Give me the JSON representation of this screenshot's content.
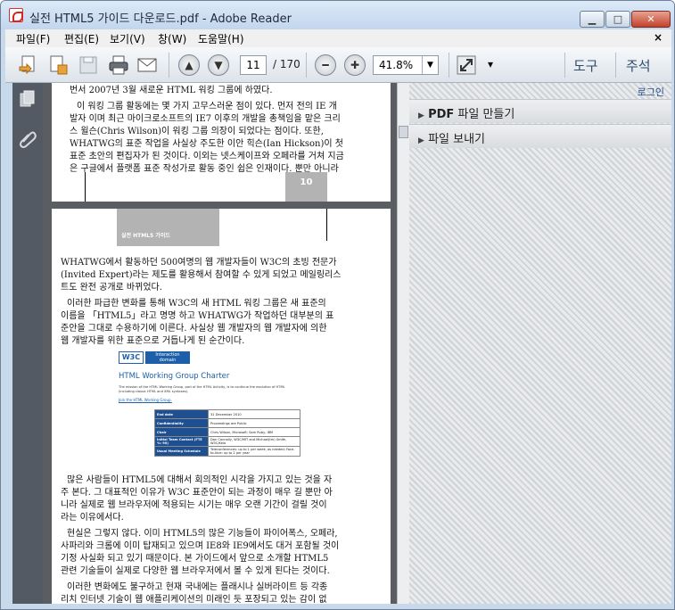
{
  "window": {
    "title": "실전 HTML5 가이드 다운로드.pdf - Adobe Reader",
    "min": "▁",
    "max": "□",
    "close": "✕"
  },
  "menu": [
    "파일(F)",
    "편집(E)",
    "보기(V)",
    "창(W)",
    "도움말(H)"
  ],
  "menu_close": "×",
  "toolbar": {
    "page_current": "11",
    "page_total": "/ 170",
    "zoom": "41.8%",
    "zoom_arrow": "▼",
    "tools": "도구",
    "comment": "주석",
    "more": "▾"
  },
  "side": {
    "login": "로그인",
    "item1_bold": "PDF",
    "item1": " 파일 만들기",
    "item2": "파일 보내기",
    "arrow": "▶"
  },
  "page10": {
    "lines": [
      "번서 2007년 3월 새로운 HTML 워킹 그룹에 하였다.",
      "이 워킹 그룹 활동에는 몇 가지 고무스러운 점이 있다. 먼저 전의 IE 개",
      "발자 이며 최근 마이크로소프트의 IE7 이후의 개발을 총책임을 맡은 크리",
      "스 윌슨(Chris Wilson)이 워킹 그룹 의장이 되었다는 점이다. 또한,",
      "WHATWG의 표준 작업을 사실상 주도한 이안 힉슨(Ian Hickson)이 첫",
      "표준 초안의 편집자가 된 것이다. 이외는 넷스케이프와 오페라를 거쳐 지금",
      "은 구글에서 플랫폼 표준 작성가로 활동 중인 쉽은 인재이다. 뿐만 아니라"
    ],
    "page_num": "10"
  },
  "page11": {
    "header": "실전 HTML5 가이드",
    "para1": [
      "WHATWG에서 활동하던 500여명의 웹 개발자들이 W3C의 초빙 전문가",
      "(Invited Expert)라는 제도를 활용해서 참여할 수 있게 되었고 메일링리스",
      "트도 완전 공개로 바뀌었다."
    ],
    "para2": [
      "이러한 파급한 변화를 통해 W3C의 새 HTML 워킹 그룹은 새 표준의",
      "이름을 「HTML5」라고 명명 하고 WHATWG가 작업하던 대부분의 표",
      "준안을 그대로 수용하기에 이른다. 사실상 웹 개발자의 웹 개발자에 의한",
      "웹 개발자를 위한 표준으로 거듭나게 된 순간이다."
    ],
    "fig": {
      "logo": "W3C",
      "domain_line1": "Interaction",
      "domain_line2": "domain",
      "heading": "HTML Working Group Charter",
      "desc": "The mission of the HTML Working Group, part of the HTML Activity, is to continue the evolution of HTML (including classic HTML and XML syntaxes).",
      "link": "Join the HTML Working Group.",
      "rows": [
        [
          "End date",
          "31 December 2010"
        ],
        [
          "Confidentiality",
          "Proceedings are Public"
        ],
        [
          "Chair",
          "Chris Wilson, Microsoft; Sam Ruby, IBM"
        ],
        [
          "Initial Team Contact (FTE %: 90)",
          "Dan Connolly, W3C/MIT and Michael(tm) Smith, W3C/Keio"
        ],
        [
          "Usual Meeting Schedule",
          "Teleconferences: up to 1 per week, as needed; Face-to-face: up to 2 per year"
        ]
      ]
    },
    "para3": [
      "많은 사람들이 HTML5에 대해서 회의적인 시각을 가지고 있는 것을 자",
      "주 본다. 그 대표적인 이유가 W3C 표준안이 되는 과정이 매우 길 뿐만 아",
      "니라 실제로 웹 브라우저에 적용되는 시기는 매우 오랜 기간이 걸릴 것이",
      "라는 이유에서다."
    ],
    "para4": [
      "현실은 그렇지 않다. 이미 HTML5의 많은 기능들이 파이어폭스, 오페라,",
      "사파리와 크롬에 이미 탑재되고 있으며 IE8와 IE9에서도 대거 포함될 것이",
      "기정 사실화 되고 있기 때문이다. 본 가이드에서 앞으로 소개할 HTML5",
      "관련 기술들이 실제로 다양한 웹 브라우저에서 볼 수 있게 된다는 것이다."
    ],
    "para5": [
      "이러한 변화에도 불구하고 현재 국내에는 플래시나 실버라이트 등 각종",
      "리치 인터넷 기술이 웹 애플리케이션의 미래인 듯 포장되고 있는 감이 없"
    ]
  }
}
